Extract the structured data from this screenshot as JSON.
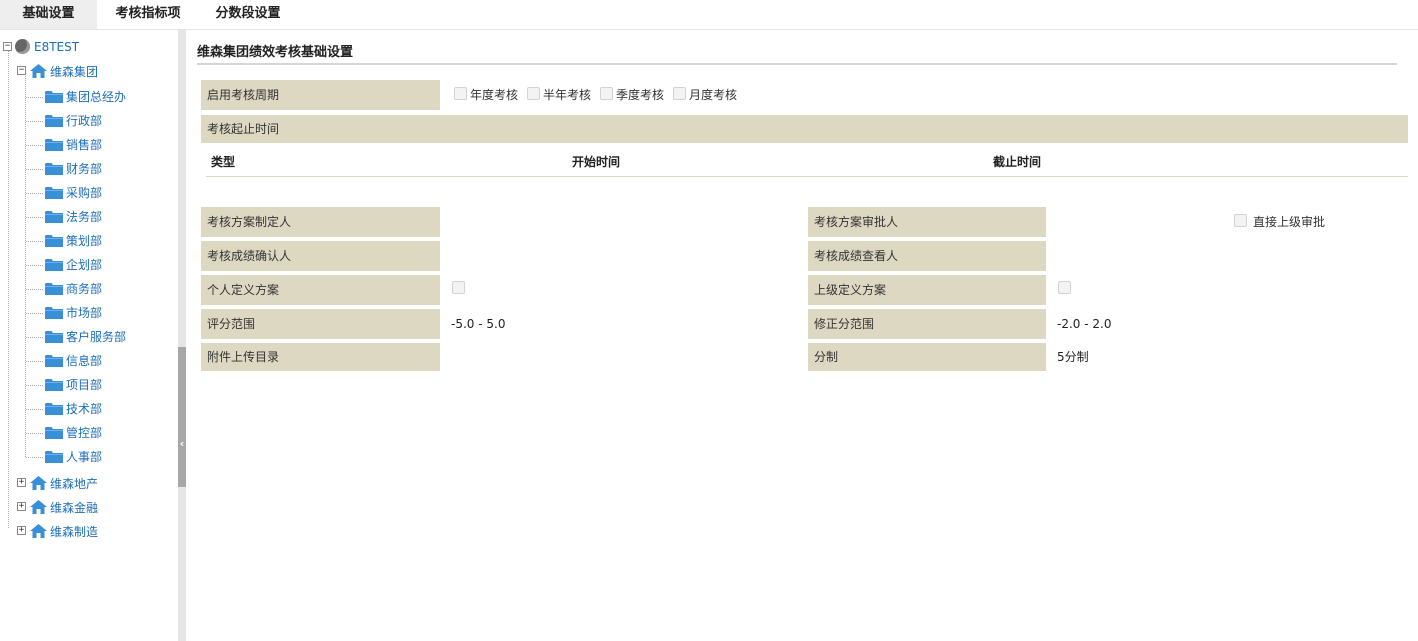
{
  "tabs": [
    {
      "label": "基础设置",
      "active": true
    },
    {
      "label": "考核指标项",
      "active": false
    },
    {
      "label": "分数段设置",
      "active": false
    }
  ],
  "tree": {
    "root": {
      "label": "E8TEST",
      "icon": "globe-icon",
      "expanded": true
    },
    "groups": [
      {
        "label": "维森集团",
        "icon": "house-icon",
        "expanded": true,
        "children": [
          "集团总经办",
          "行政部",
          "销售部",
          "财务部",
          "采购部",
          "法务部",
          "策划部",
          "企划部",
          "商务部",
          "市场部",
          "客户服务部",
          "信息部",
          "项目部",
          "技术部",
          "管控部",
          "人事部"
        ]
      },
      {
        "label": "维森地产",
        "icon": "house-icon",
        "expanded": false,
        "children": []
      },
      {
        "label": "维森金融",
        "icon": "house-icon",
        "expanded": false,
        "children": []
      },
      {
        "label": "维森制造",
        "icon": "house-icon",
        "expanded": false,
        "children": []
      }
    ]
  },
  "main": {
    "title": "维森集团绩效考核基础设置",
    "cycle": {
      "label": "启用考核周期",
      "options": [
        {
          "label": "年度考核",
          "checked": false
        },
        {
          "label": "半年考核",
          "checked": false
        },
        {
          "label": "季度考核",
          "checked": false
        },
        {
          "label": "月度考核",
          "checked": false
        }
      ]
    },
    "period": {
      "label": "考核起止时间",
      "columns": [
        "类型",
        "开始时间",
        "截止时间"
      ]
    },
    "fields": {
      "plan_maker": {
        "label": "考核方案制定人",
        "value": ""
      },
      "plan_approver": {
        "label": "考核方案审批人",
        "value": ""
      },
      "direct_superior": {
        "label": "直接上级审批",
        "checked": false
      },
      "result_confirmer": {
        "label": "考核成绩确认人",
        "value": ""
      },
      "result_viewer": {
        "label": "考核成绩查看人",
        "value": ""
      },
      "personal_plan": {
        "label": "个人定义方案",
        "checked": false
      },
      "superior_plan": {
        "label": "上级定义方案",
        "checked": false
      },
      "score_range": {
        "label": "评分范围",
        "value": "-5.0 - 5.0"
      },
      "adjust_range": {
        "label": "修正分范围",
        "value": "-2.0 - 2.0"
      },
      "attachment_dir": {
        "label": "附件上传目录",
        "value": ""
      },
      "score_system": {
        "label": "分制",
        "value": "5分制"
      }
    }
  },
  "colors": {
    "label_bg": "#ddd8c2",
    "tree_text": "#1d6eb8",
    "icon_blue": "#3a8fd9"
  }
}
